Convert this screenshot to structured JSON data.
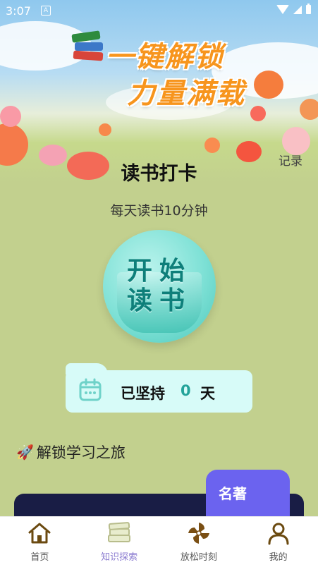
{
  "status_bar": {
    "time": "3:07",
    "a_indicator": "A"
  },
  "banner": {
    "line1": "一键解锁",
    "line2": "力量满载"
  },
  "checkin": {
    "title": "读书打卡",
    "record_link": "记录",
    "subtitle": "每天读书10分钟",
    "start_line1": "开始",
    "start_line2": "读书",
    "persist_label": "已坚持",
    "persist_count": "0",
    "persist_unit": "天"
  },
  "journey": {
    "label": "解锁学习之旅"
  },
  "classics": {
    "label": "名著"
  },
  "tabs": [
    {
      "label": "首页",
      "icon": "home-icon"
    },
    {
      "label": "知识探索",
      "icon": "books-icon",
      "active": true
    },
    {
      "label": "放松时刻",
      "icon": "pinwheel-icon"
    },
    {
      "label": "我的",
      "icon": "user-icon"
    }
  ],
  "colors": {
    "background": "#c2d08e",
    "accent": "#6b63ef",
    "teal": "#23a39a"
  }
}
